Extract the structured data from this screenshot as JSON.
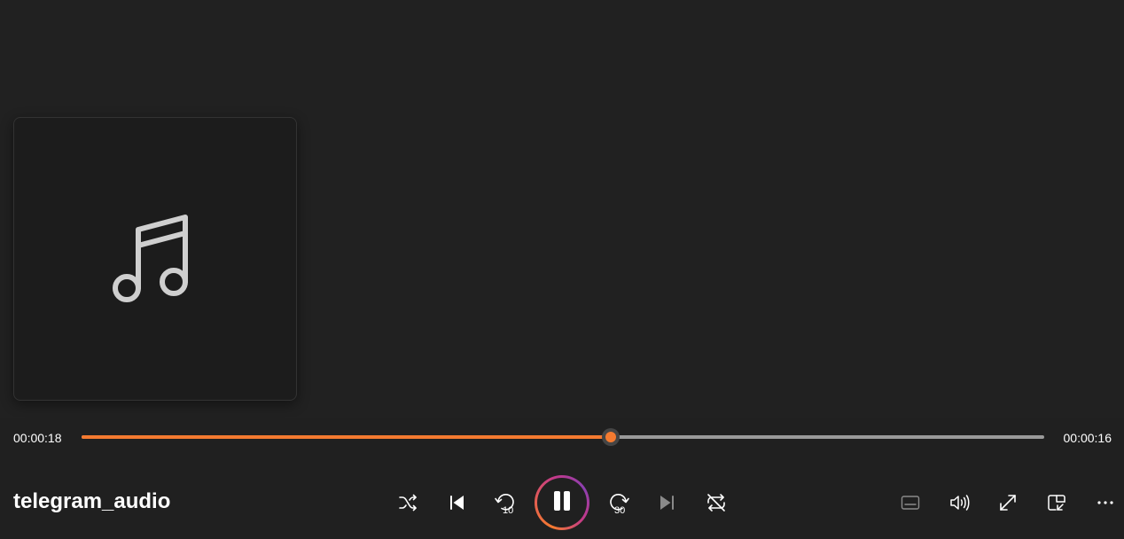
{
  "media": {
    "title": "telegram_audio",
    "elapsed": "00:00:18",
    "remaining": "00:00:16",
    "progress_fraction": 0.55
  },
  "artwork": {
    "icon": "music-note-icon"
  },
  "transport": [
    {
      "name": "shuffle-button",
      "icon": "shuffle-icon"
    },
    {
      "name": "previous-button",
      "icon": "previous-track-icon"
    },
    {
      "name": "skip-back-10-button",
      "icon": "rewind-10-icon",
      "label": "10"
    },
    {
      "name": "play-pause-button",
      "icon": "pause-icon"
    },
    {
      "name": "skip-forward-30-button",
      "icon": "forward-30-icon",
      "label": "30"
    },
    {
      "name": "next-button",
      "icon": "next-track-icon"
    },
    {
      "name": "repeat-button",
      "icon": "repeat-icon"
    }
  ],
  "right_controls": [
    {
      "name": "captions-button",
      "icon": "captions-icon"
    },
    {
      "name": "volume-button",
      "icon": "volume-icon"
    },
    {
      "name": "fullscreen-button",
      "icon": "fullscreen-icon"
    },
    {
      "name": "miniplayer-button",
      "icon": "miniplayer-icon"
    },
    {
      "name": "more-options-button",
      "icon": "more-icon"
    }
  ],
  "colors": {
    "background": "#212121",
    "accent": "#f47a30",
    "track": "#9a9a9a",
    "icon": "#ffffff",
    "icon_disabled": "#8a8a8a",
    "artwork_icon": "#cfcfcf"
  }
}
